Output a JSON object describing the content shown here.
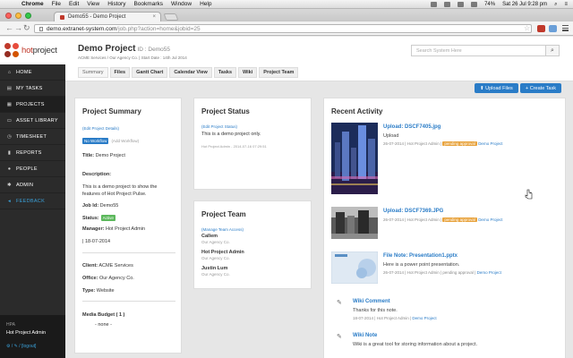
{
  "os_menu": {
    "app": "Chrome",
    "items": [
      "File",
      "Edit",
      "View",
      "History",
      "Bookmarks",
      "Window",
      "Help"
    ],
    "battery": "74%",
    "clock": "Sat 26 Jul  9:28 pm"
  },
  "browser": {
    "tab_title": "Demo55 - Demo Project",
    "url_host": "demo.extranet-system.com",
    "url_path": "/job.php?action=home&jobid=25"
  },
  "sidebar": {
    "logo_text_a": "hot",
    "logo_text_b": "project",
    "items": [
      {
        "label": "HOME",
        "icon": "home-icon",
        "glyph": "⌂"
      },
      {
        "label": "MY TASKS",
        "icon": "tasks-icon",
        "glyph": "▤"
      },
      {
        "label": "PROJECTS",
        "icon": "projects-icon",
        "glyph": "▦"
      },
      {
        "label": "ASSET LIBRARY",
        "icon": "library-icon",
        "glyph": "▭"
      },
      {
        "label": "TIMESHEET",
        "icon": "clock-icon",
        "glyph": "◷"
      },
      {
        "label": "REPORTS",
        "icon": "chart-icon",
        "glyph": "▮"
      },
      {
        "label": "PEOPLE",
        "icon": "people-icon",
        "glyph": "●"
      },
      {
        "label": "ADMIN",
        "icon": "gear-icon",
        "glyph": "✱"
      },
      {
        "label": "FEEDBACK",
        "icon": "feedback-icon",
        "glyph": "◂"
      }
    ],
    "user_org": "HPA",
    "user_name": "Hot Project Admin",
    "user_links": "⚙ / ✎ / [logout]"
  },
  "header": {
    "project_title": "Demo Project",
    "project_id": "ID : Demo55",
    "meta": "ACME Services / Our Agency Co. | Start Date : 14th Jul 2014",
    "search_placeholder": "Search System Here",
    "tabs": [
      "Summary",
      "Files",
      "Gantt Chart",
      "Calendar View",
      "Tasks",
      "Wiki",
      "Project Team"
    ],
    "upload_button": "⬆ Upload Files",
    "create_task_button": "+ Create Task"
  },
  "summary": {
    "heading": "Project Summary",
    "edit_link": "(Edit Project Details)",
    "workflow_badge": "No Workflow",
    "add_workflow": "(Add Workflow)",
    "title_label": "Title:",
    "title_value": "Demo Project",
    "description_label": "Description:",
    "description_value": "This is a demo project to show the features of Hot Project Pulse.",
    "jobid_label": "Job Id:",
    "jobid_value": "Demo55",
    "status_label": "Status:",
    "status_badge": "Active",
    "manager_label": "Manager:",
    "manager_value": "Hot Project Admin",
    "date_value": "| 18-07-2014",
    "client_label": "Client:",
    "client_value": "ACME Services",
    "office_label": "Office:",
    "office_value": "Our Agency Co.",
    "type_label": "Type:",
    "type_value": "Website",
    "budget_label": "Media Budget ( 1 )",
    "budget_value": "- none -"
  },
  "status_card": {
    "heading": "Project Status",
    "edit_link": "(Edit Project Status)",
    "text": "This is a demo project only.",
    "meta": "Hot Project Admin - 2014-07-16 07:29:51"
  },
  "team_card": {
    "heading": "Project Team",
    "manage_link": "(Manage Team Access)",
    "members": [
      {
        "name": "Callem",
        "org": "Our Agency Co."
      },
      {
        "name": "Hot Project Admin",
        "org": "Our Agency Co."
      },
      {
        "name": "Justin Lum",
        "org": "Our Agency Co."
      }
    ]
  },
  "activity": {
    "heading": "Recent Activity",
    "items": [
      {
        "title": "Upload: DSCF7405.jpg",
        "sub": "Upload",
        "date": "26-07-2014 | Hot Project Admin |",
        "badge": "pending approval",
        "project": "Demo Project"
      },
      {
        "title": "Upload: DSCF7369.JPG",
        "sub": "",
        "date": "26-07-2014 | Hot Project Admin |",
        "badge": "pending approval",
        "project": "Demo Project"
      },
      {
        "title": "File Note: Presentation1.pptx",
        "sub": "Here is a power point presentation.",
        "date": "26-07-2014 | Hot Project Admin | pending approval |",
        "badge": "",
        "project": "Demo Project"
      },
      {
        "title": "Wiki Comment",
        "sub": "Thanks for this note.",
        "date": "18-07-2014 | Hot Project Admin |",
        "badge": "",
        "project": "Demo Project"
      },
      {
        "title": "Wiki Note",
        "sub": "Wiki is a great tool for storing information about a project.",
        "date": "",
        "badge": "",
        "project": ""
      }
    ]
  },
  "colors": {
    "accent": "#2a7cc7",
    "brand": "#c0392b",
    "sidebar": "#2b2b2b",
    "pending": "#e8a33d",
    "active": "#5cb85c"
  }
}
